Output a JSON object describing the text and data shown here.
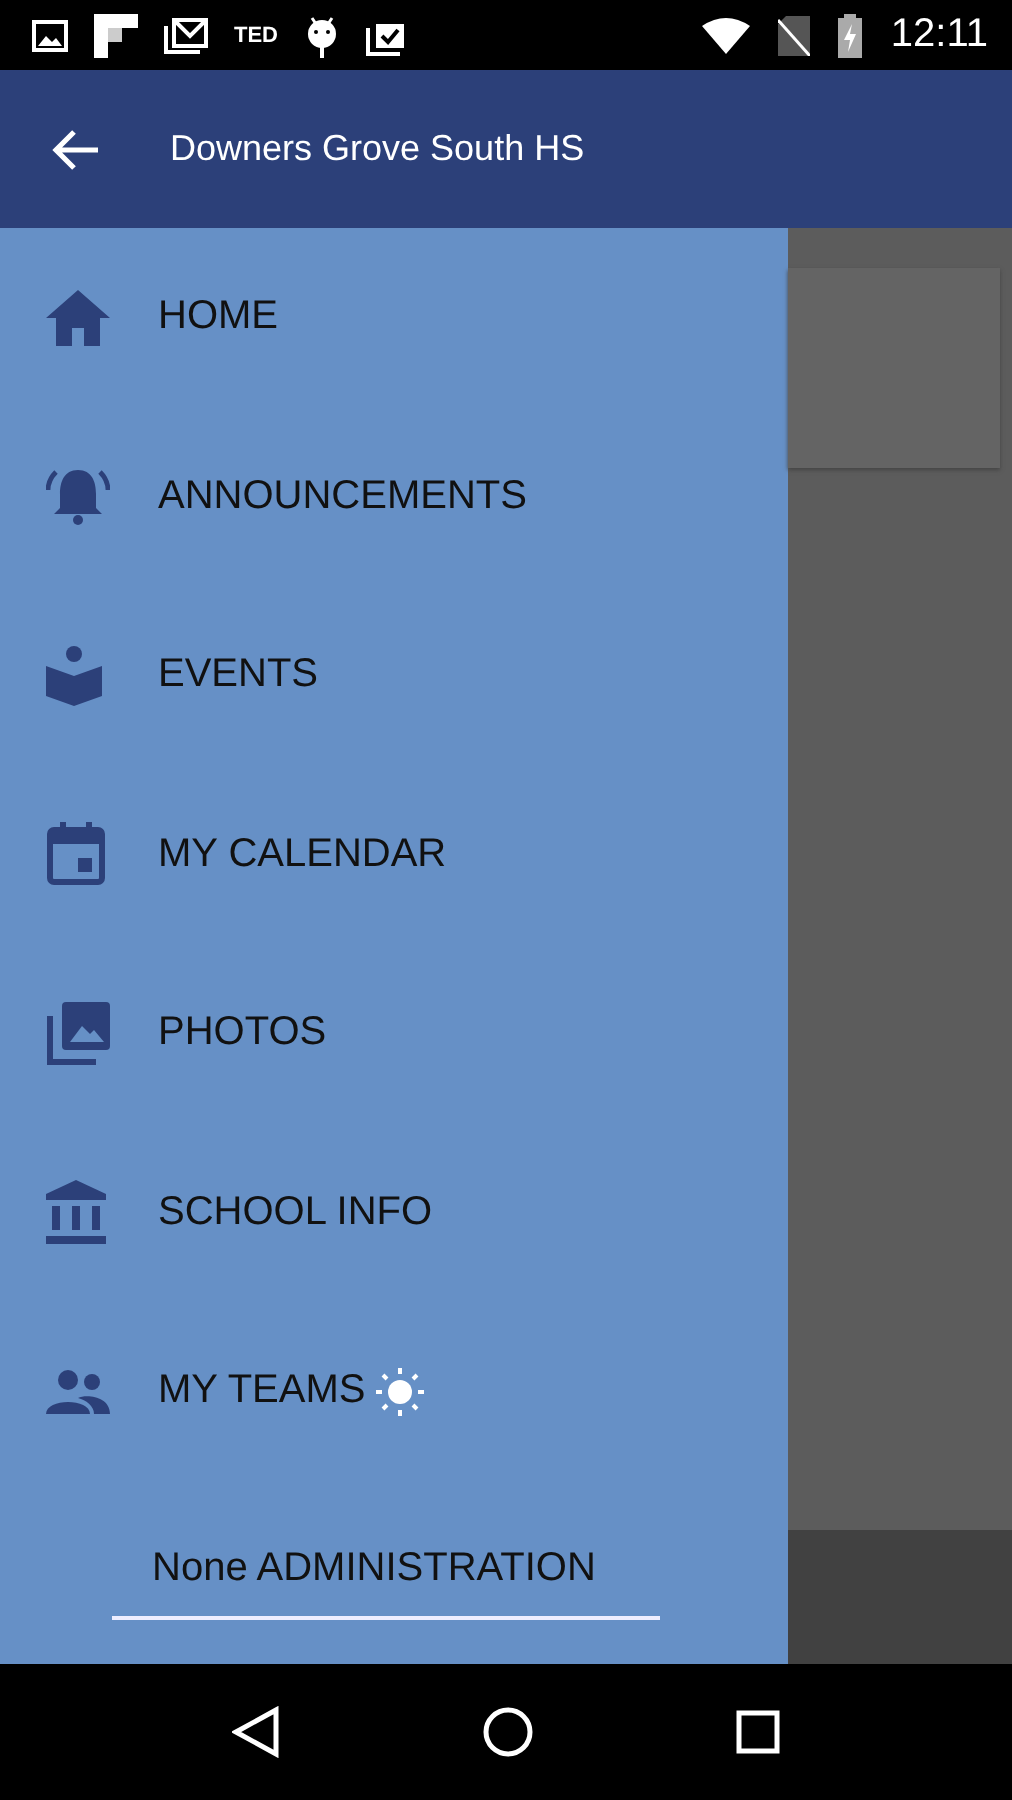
{
  "status_bar": {
    "notification_text": "TED",
    "time": "12:11"
  },
  "header": {
    "title": "Downers Grove South HS"
  },
  "menu": [
    {
      "kind": "home",
      "label": "HOME",
      "badge": false
    },
    {
      "kind": "bell",
      "label": "ANNOUNCEMENTS",
      "badge": false
    },
    {
      "kind": "reader",
      "label": "EVENTS",
      "badge": false
    },
    {
      "kind": "calendar",
      "label": "MY CALENDAR",
      "badge": false
    },
    {
      "kind": "photos",
      "label": "PHOTOS",
      "badge": false
    },
    {
      "kind": "bank",
      "label": "SCHOOL INFO",
      "badge": false
    },
    {
      "kind": "people",
      "label": "MY TEAMS",
      "badge": true
    }
  ],
  "team_selector": {
    "value": "None ADMINISTRATION"
  }
}
